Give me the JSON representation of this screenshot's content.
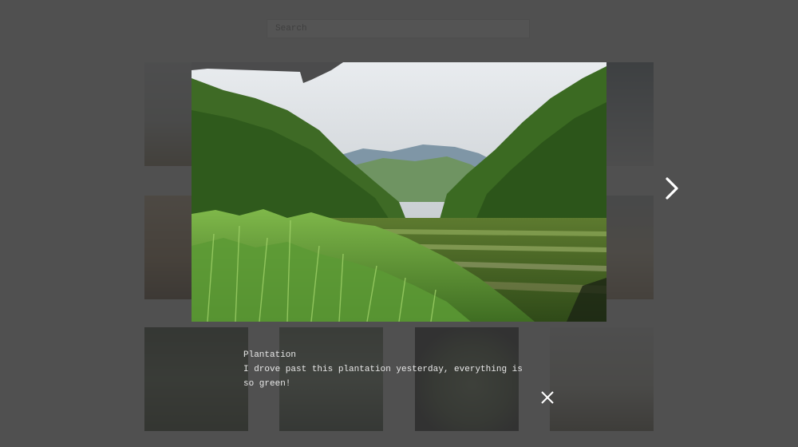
{
  "search": {
    "placeholder": "Search"
  },
  "gallery": {
    "thumbnails": [
      "thumb-1",
      "thumb-2",
      "thumb-3",
      "thumb-4",
      "thumb-5",
      "thumb-6",
      "thumb-7",
      "thumb-8"
    ]
  },
  "lightbox": {
    "caption_title": "Plantation",
    "caption_text": "I drove past this plantation yesterday, everything is so green!",
    "next_icon": "chevron-right-icon",
    "close_icon": "close-icon"
  },
  "colors": {
    "overlay": "#343434",
    "caption_text": "#e8e8e8",
    "controls": "#ffffff"
  }
}
